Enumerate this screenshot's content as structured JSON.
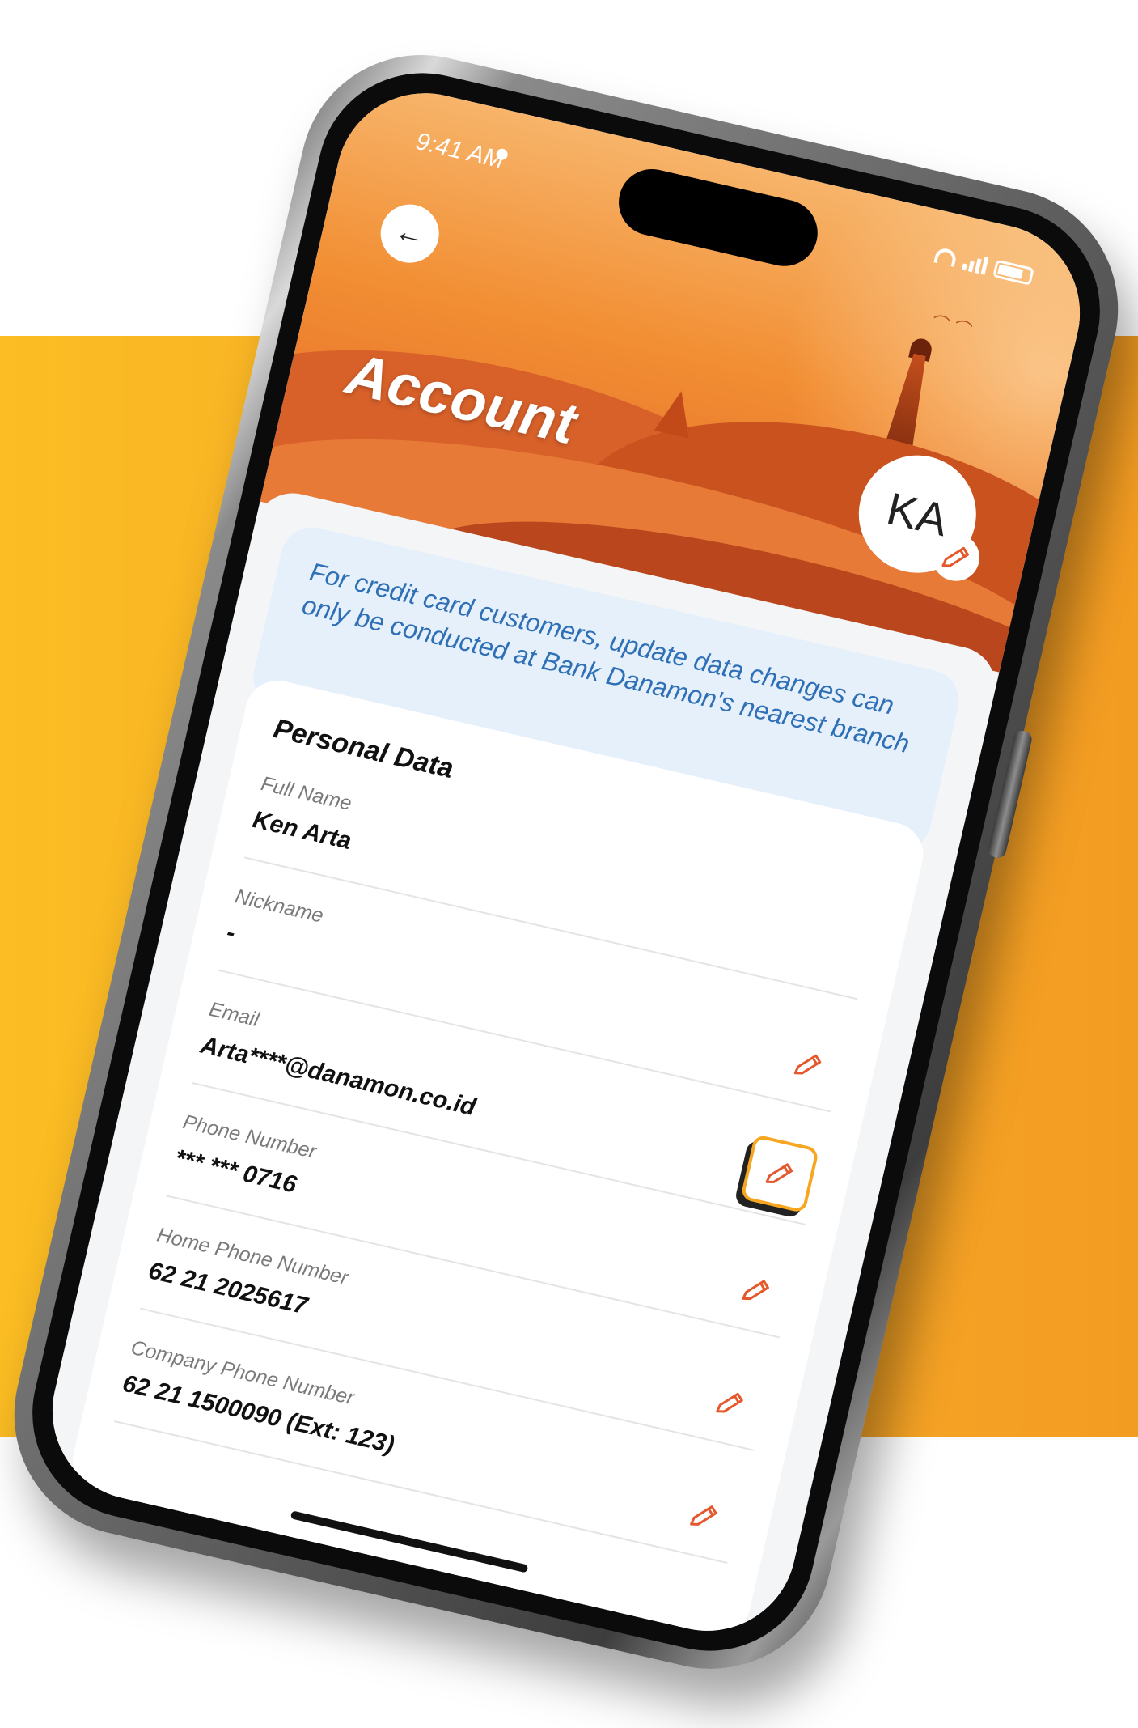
{
  "colors": {
    "background_band": "#f7a928",
    "header_orange": "#f28e33",
    "notice_bg": "#e5f0fb",
    "notice_text": "#2e6fb6",
    "edit_icon": "#e4582b",
    "highlight_border": "#f6a621"
  },
  "status_bar": {
    "time": "9:41 AM",
    "icons": [
      "alarm-icon",
      "wifi-icon",
      "signal-icon",
      "battery-icon"
    ]
  },
  "header": {
    "back_icon": "arrow-left-icon",
    "back_symbol": "←",
    "title": "Account",
    "avatar_initials": "KA"
  },
  "notice": {
    "text": "For credit card customers, update data changes can only be conducted at Bank Danamon's nearest branch"
  },
  "personal_data": {
    "title": "Personal Data",
    "fields": [
      {
        "label": "Full Name",
        "value": "Ken Arta",
        "editable": false
      },
      {
        "label": "Nickname",
        "value": "-",
        "editable": true
      },
      {
        "label": "Email",
        "value": "Arta****@danamon.co.id",
        "editable": true,
        "highlighted": true
      },
      {
        "label": "Phone Number",
        "value": "*** *** 0716",
        "editable": true
      },
      {
        "label": "Home Phone Number",
        "value": "62 21 2025617",
        "editable": true
      },
      {
        "label": "Company Phone Number",
        "value": "62 21 1500090 (Ext: 123)",
        "editable": true
      }
    ]
  }
}
